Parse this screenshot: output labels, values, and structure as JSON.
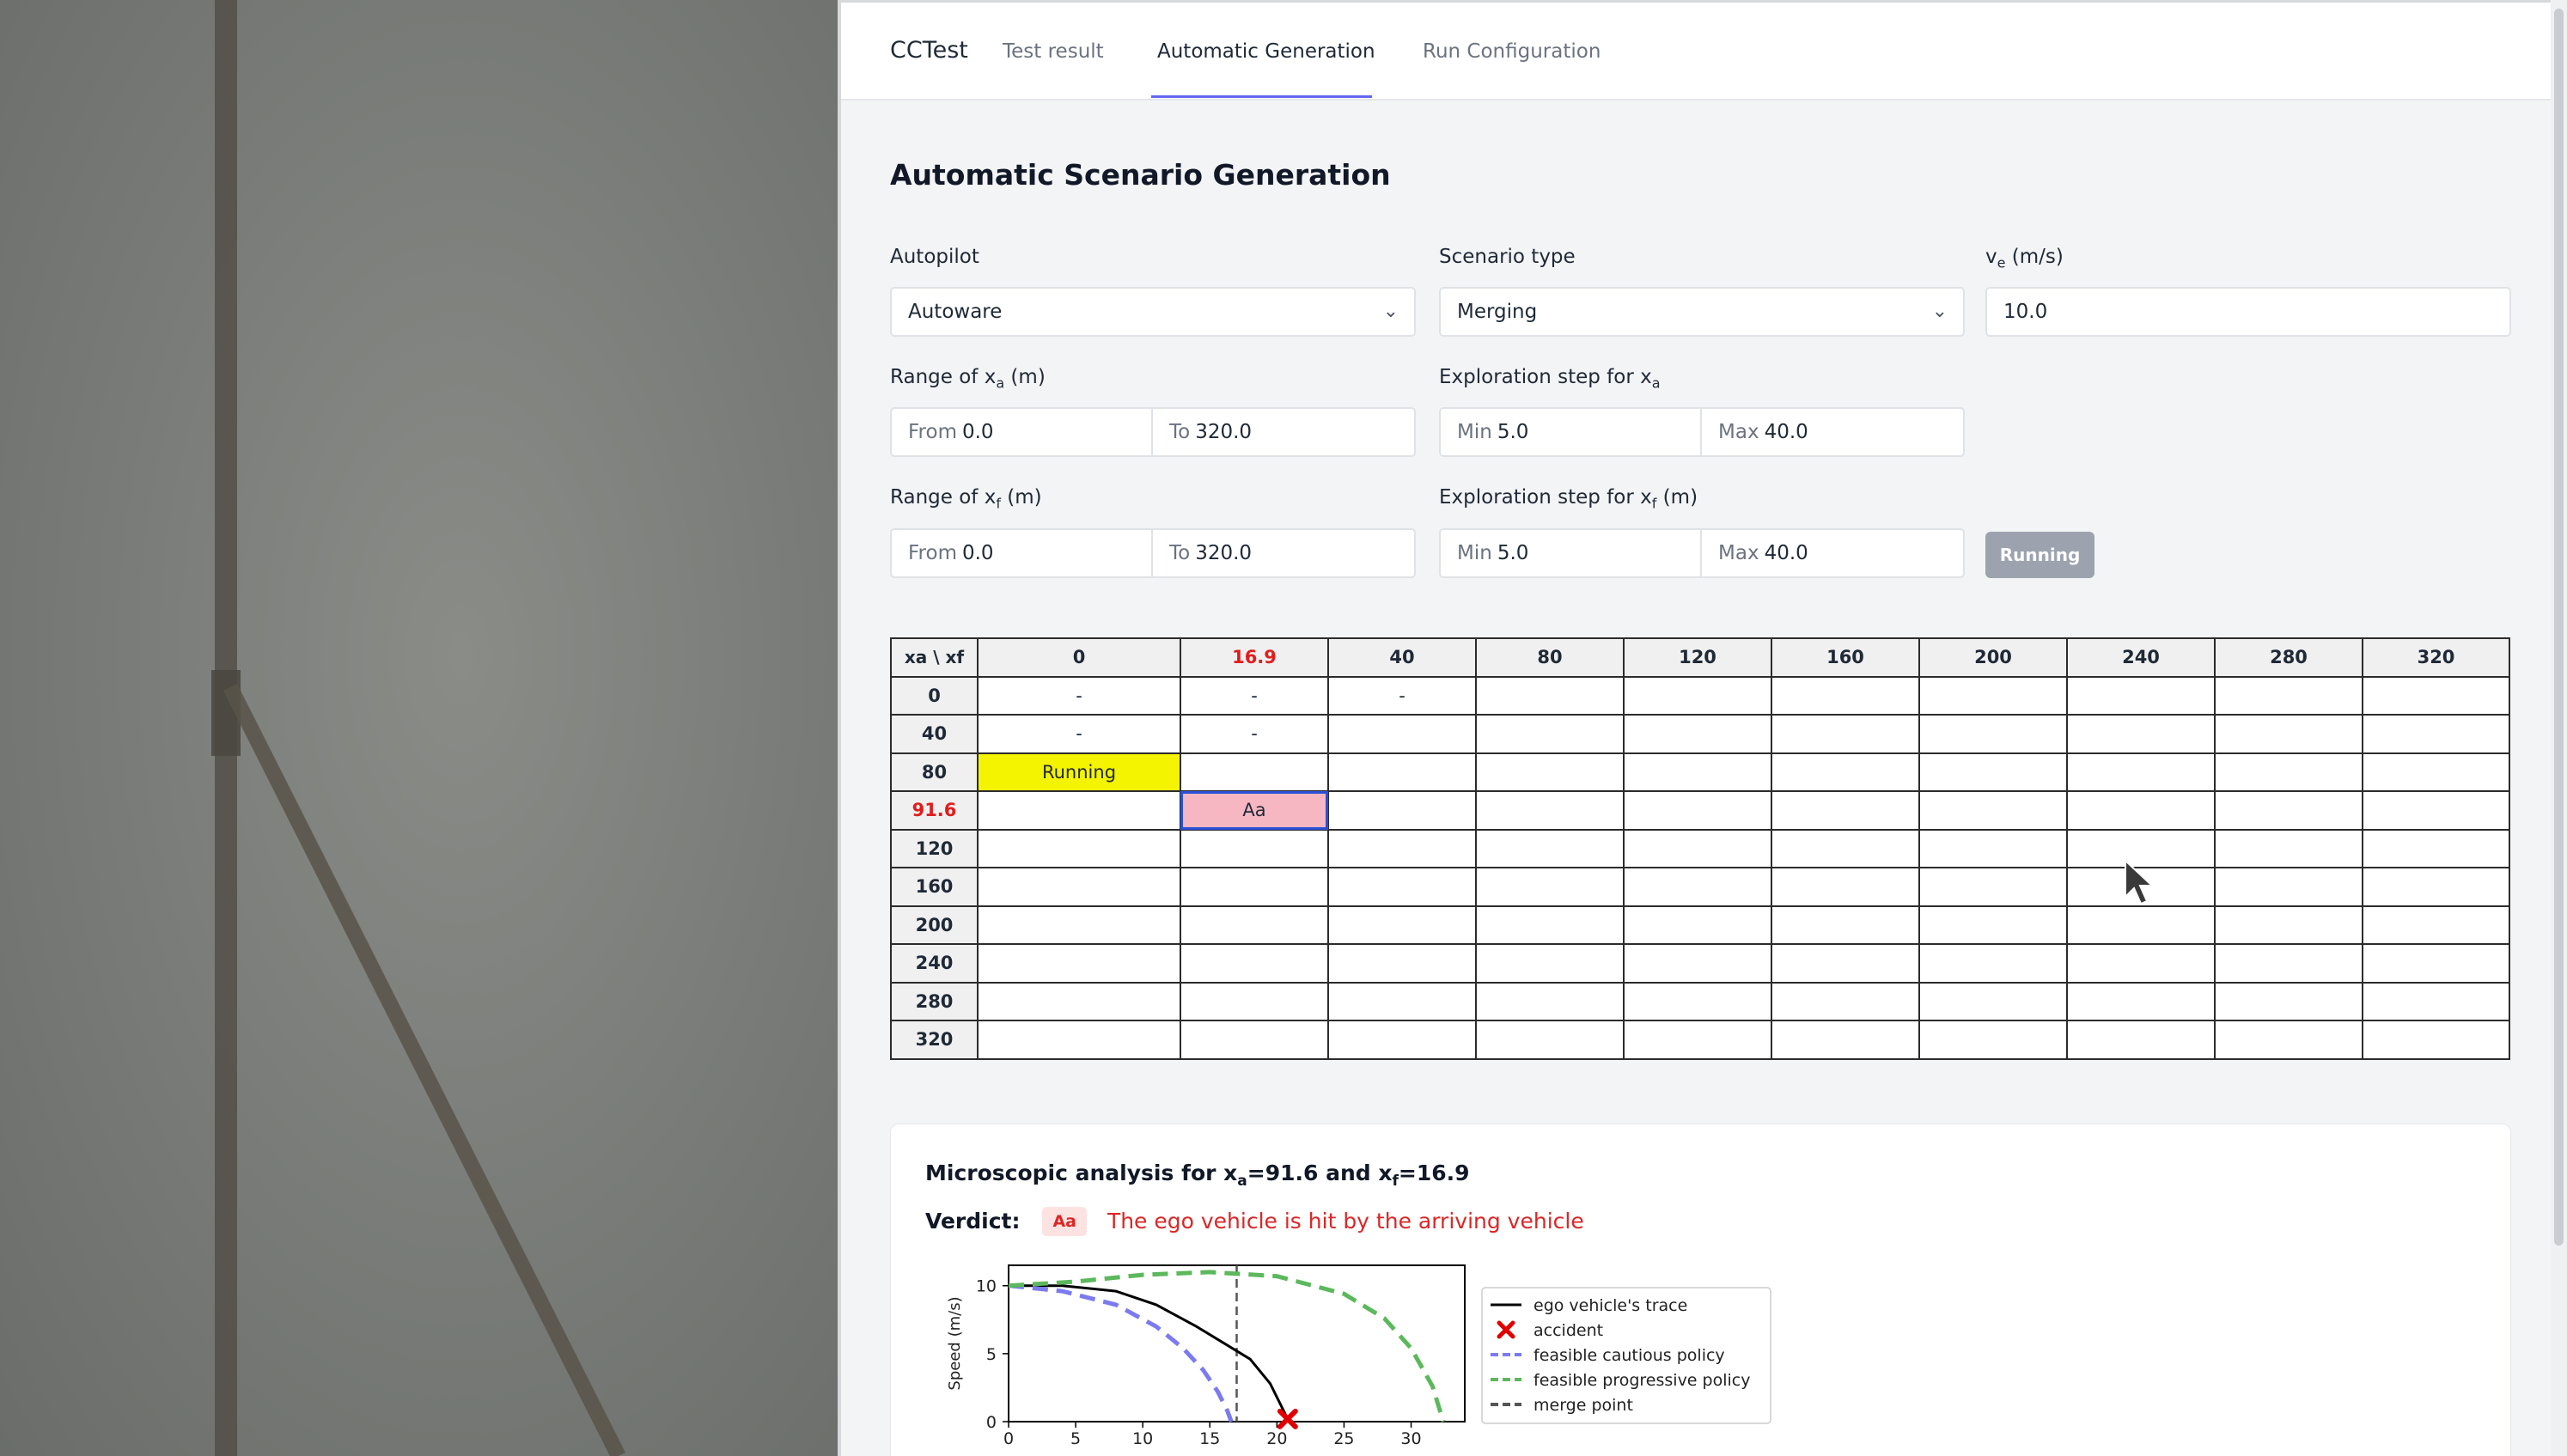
{
  "nav": {
    "brand": "CCTest",
    "tabs": [
      {
        "label": "Test result"
      },
      {
        "label": "Automatic Generation",
        "active": true
      },
      {
        "label": "Run Configuration"
      }
    ]
  },
  "page_title": "Automatic Scenario Generation",
  "form": {
    "autopilot": {
      "label": "Autopilot",
      "value": "Autoware"
    },
    "scenario_type": {
      "label": "Scenario type",
      "value": "Merging"
    },
    "ve": {
      "label_main": "v",
      "label_sub": "e",
      "label_rest": " (m/s)",
      "value": "10.0"
    },
    "range_xa": {
      "label_main": "Range of x",
      "label_sub": "a",
      "label_rest": " (m)",
      "from_prefix": "From",
      "from": "0.0",
      "to_prefix": "To",
      "to": "320.0"
    },
    "step_xa": {
      "label_main": "Exploration step for x",
      "label_sub": "a",
      "label_rest": "",
      "min_prefix": "Min",
      "min": "5.0",
      "max_prefix": "Max",
      "max": "40.0"
    },
    "range_xf": {
      "label_main": "Range of x",
      "label_sub": "f",
      "label_rest": " (m)",
      "from_prefix": "From",
      "from": "0.0",
      "to_prefix": "To",
      "to": "320.0"
    },
    "step_xf": {
      "label_main": "Exploration step for x",
      "label_sub": "f",
      "label_rest": " (m)",
      "min_prefix": "Min",
      "min": "5.0",
      "max_prefix": "Max",
      "max": "40.0"
    },
    "run_button": "Running"
  },
  "grid": {
    "corner": "xa \\ xf",
    "columns": [
      "0",
      "16.9",
      "40",
      "80",
      "120",
      "160",
      "200",
      "240",
      "280",
      "320"
    ],
    "highlight_column": "16.9",
    "rows": [
      {
        "label": "0",
        "cells": [
          "-",
          "-",
          "-",
          "",
          "",
          "",
          "",
          "",
          "",
          ""
        ]
      },
      {
        "label": "40",
        "cells": [
          "-",
          "-",
          "",
          "",
          "",
          "",
          "",
          "",
          "",
          ""
        ]
      },
      {
        "label": "80",
        "cells": [
          "Running",
          "",
          "",
          "",
          "",
          "",
          "",
          "",
          "",
          ""
        ],
        "states": [
          "running"
        ]
      },
      {
        "label": "91.6",
        "highlight": true,
        "cells": [
          "",
          "Aa",
          "",
          "",
          "",
          "",
          "",
          "",
          "",
          ""
        ],
        "states": [
          "",
          "accident"
        ]
      },
      {
        "label": "120",
        "cells": [
          "",
          "",
          "",
          "",
          "",
          "",
          "",
          "",
          "",
          ""
        ]
      },
      {
        "label": "160",
        "cells": [
          "",
          "",
          "",
          "",
          "",
          "",
          "",
          "",
          "",
          ""
        ]
      },
      {
        "label": "200",
        "cells": [
          "",
          "",
          "",
          "",
          "",
          "",
          "",
          "",
          "",
          ""
        ]
      },
      {
        "label": "240",
        "cells": [
          "",
          "",
          "",
          "",
          "",
          "",
          "",
          "",
          "",
          ""
        ]
      },
      {
        "label": "280",
        "cells": [
          "",
          "",
          "",
          "",
          "",
          "",
          "",
          "",
          "",
          ""
        ]
      },
      {
        "label": "320",
        "cells": [
          "",
          "",
          "",
          "",
          "",
          "",
          "",
          "",
          "",
          ""
        ]
      }
    ],
    "colors": {
      "running": "#f4f300",
      "accident": "#f7b7c2",
      "highlight_text": "#e11d1d"
    }
  },
  "analysis": {
    "title_parts": [
      "Microscopic analysis for x",
      "a",
      "=91.6 and x",
      "f",
      "=16.9"
    ],
    "verdict_label": "Verdict:",
    "verdict_badge": "Aa",
    "verdict_text": "The ego vehicle is hit by the arriving vehicle"
  },
  "chart_data": {
    "type": "line",
    "ylabel": "Speed (m/s)",
    "xlabel": "",
    "xlim": [
      0,
      34
    ],
    "ylim": [
      0,
      11.5
    ],
    "xticks": [
      0,
      5,
      10,
      15,
      20,
      25,
      30
    ],
    "yticks": [
      0,
      5,
      10
    ],
    "legend_position": "right",
    "series": [
      {
        "name": "ego vehicle's trace",
        "style": "solid",
        "color": "#000000",
        "points": [
          [
            0,
            10
          ],
          [
            4,
            10
          ],
          [
            8,
            9.6
          ],
          [
            11,
            8.6
          ],
          [
            14,
            7.0
          ],
          [
            16,
            5.8
          ],
          [
            18,
            4.6
          ],
          [
            19.5,
            2.8
          ],
          [
            20.4,
            1.0
          ],
          [
            20.8,
            0.2
          ]
        ]
      },
      {
        "name": "feasible cautious policy",
        "style": "dashed",
        "color": "#7b7bef",
        "points": [
          [
            0,
            10
          ],
          [
            4,
            9.6
          ],
          [
            8,
            8.6
          ],
          [
            11,
            7.0
          ],
          [
            13,
            5.4
          ],
          [
            14.5,
            3.8
          ],
          [
            15.6,
            2.2
          ],
          [
            16.3,
            0.8
          ],
          [
            16.6,
            0
          ]
        ]
      },
      {
        "name": "feasible progressive policy",
        "style": "dashed",
        "color": "#5cb85c",
        "points": [
          [
            0,
            10
          ],
          [
            5,
            10.3
          ],
          [
            10,
            10.8
          ],
          [
            15,
            11.0
          ],
          [
            20,
            10.7
          ],
          [
            25,
            9.4
          ],
          [
            28,
            7.6
          ],
          [
            30,
            5.4
          ],
          [
            31.6,
            2.6
          ],
          [
            32.4,
            0
          ]
        ]
      }
    ],
    "accident": {
      "name": "accident",
      "x": 20.8,
      "y": 0.2,
      "color": "#e00000"
    },
    "merge_point": {
      "name": "merge point",
      "x": 17,
      "color": "#555555"
    }
  }
}
